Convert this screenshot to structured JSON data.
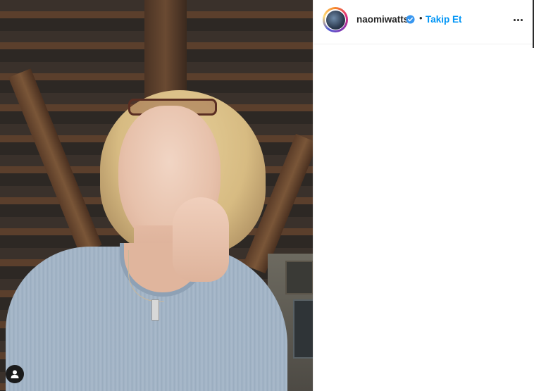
{
  "post": {
    "username": "naomiwatts",
    "verified": true,
    "separator": "•",
    "follow_label": "Takip Et",
    "more_options_icon": "more-horizontal-icon",
    "avatar_icon": "profile-avatar",
    "tag_people_icon": "user-icon"
  },
  "colors": {
    "accent": "#0095f6",
    "text": "#262626",
    "verified_badge": "#3897f0"
  }
}
